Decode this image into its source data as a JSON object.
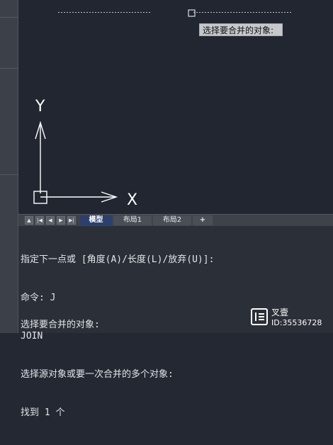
{
  "tooltip": {
    "text": "选择要合并的对象:"
  },
  "ucs": {
    "y_label": "Y",
    "x_label": "X"
  },
  "tabs": {
    "nav": [
      "▲",
      "|◀",
      "◀",
      "▶",
      "▶|"
    ],
    "items": [
      "模型",
      "布局1",
      "布局2",
      "+"
    ]
  },
  "command_history": [
    "指定下一点或 [角度(A)/长度(L)/放弃(U)]:",
    "命令: J",
    "JOIN",
    "选择源对象或要一次合并的多个对象:",
    "找到 1 个"
  ],
  "command_prompt": "选择要合并的对象:",
  "watermark": {
    "name": "叉壹",
    "id": "ID:35536728"
  },
  "colors": {
    "canvas": "#212631",
    "command_bg": "#2b2f38",
    "active_tab": "#2c3f6d",
    "ucs": "#ffffff"
  }
}
